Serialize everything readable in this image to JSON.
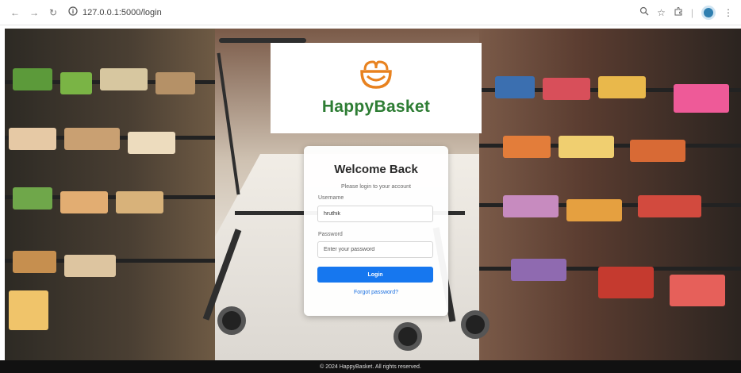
{
  "browser": {
    "url": "127.0.0.1:5000/login"
  },
  "brand": {
    "name": "HappyBasket",
    "color": "#2e7d34",
    "logo_color": "#e8821f"
  },
  "login": {
    "title": "Welcome Back",
    "subtitle": "Please login to your account",
    "username_label": "Username",
    "username_value": "hruthik",
    "password_label": "Password",
    "password_placeholder": "Enter your password",
    "login_button": "Login",
    "forgot_link": "Forgot password?",
    "button_color": "#1677ef"
  },
  "footer": {
    "text": "© 2024 HappyBasket. All rights reserved."
  }
}
